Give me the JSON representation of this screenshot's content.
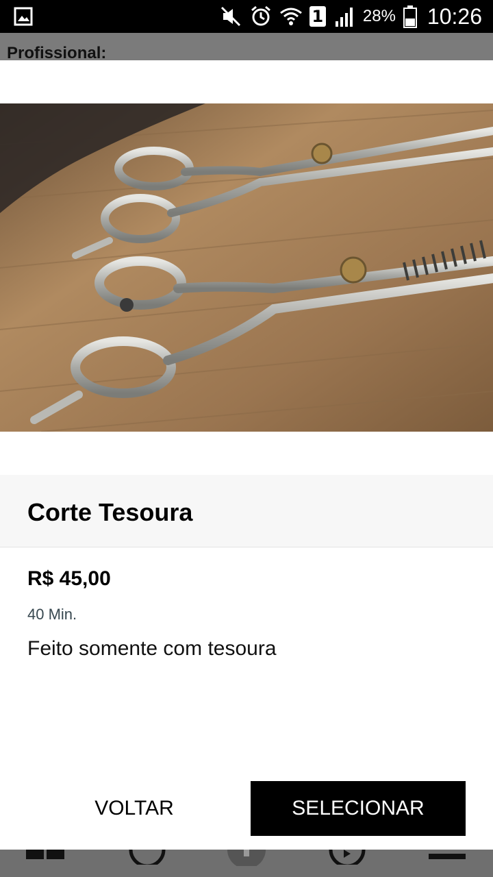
{
  "status_bar": {
    "battery_percent": "28%",
    "time": "10:26",
    "sim_slot": "1",
    "icons": [
      "gallery-icon",
      "mute-icon",
      "alarm-icon",
      "wifi-icon",
      "sim-1-icon",
      "signal-icon",
      "battery-icon"
    ]
  },
  "background_page": {
    "label": "Profissional:",
    "nav_icons": [
      "grid-icon",
      "back-circle-icon",
      "center-icon",
      "play-circle-icon",
      "menu-icon"
    ]
  },
  "service": {
    "image_alt": "scissors-photo",
    "title": "Corte Tesoura",
    "price": "R$ 45,00",
    "duration": "40 Min.",
    "description": "Feito somente com tesoura"
  },
  "actions": {
    "back_label": "VOLTAR",
    "select_label": "SELECIONAR"
  },
  "colors": {
    "primary_button": "#000000",
    "title_band": "#f7f7f7",
    "duration_text": "#37474f"
  }
}
